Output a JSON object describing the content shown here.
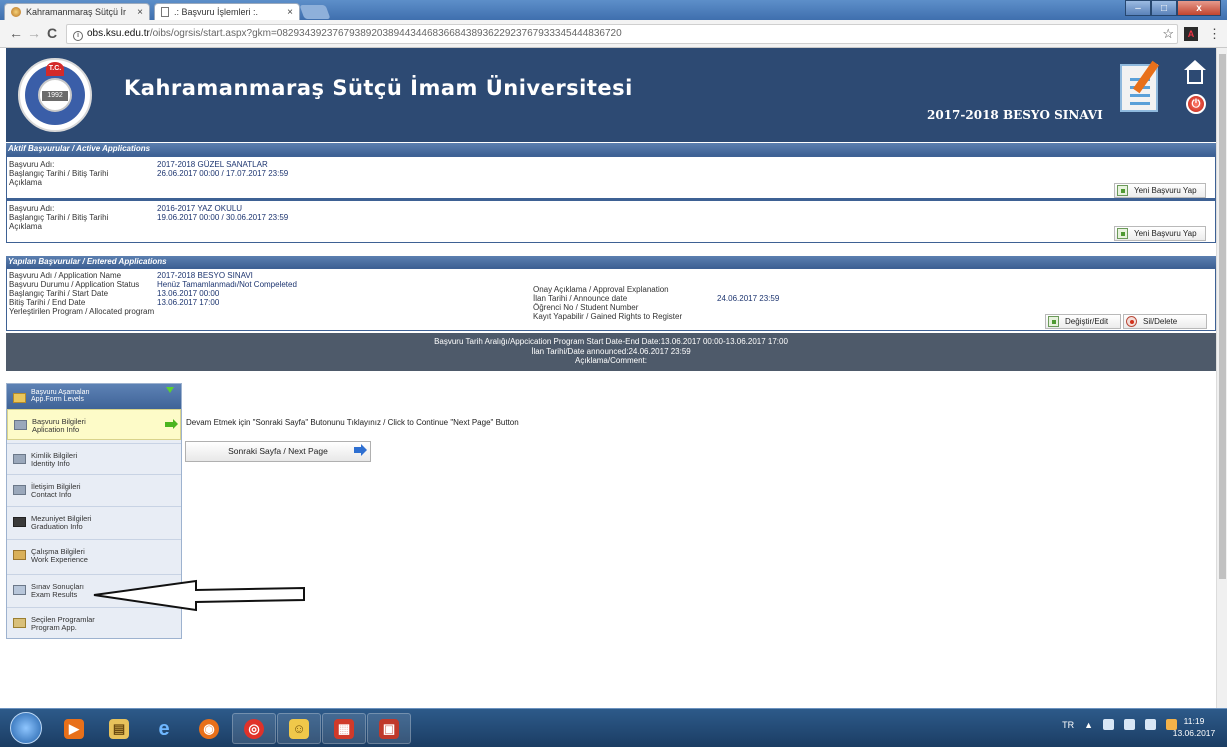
{
  "browser": {
    "tabs": [
      {
        "title": "Kahramanmaraş Sütçü İr"
      },
      {
        "title": ".: Başvuru İşlemleri :."
      }
    ],
    "close_glyph": "×",
    "url_host": "obs.ksu.edu.tr",
    "url_path": "/oibs/ogrsis/start.aspx?gkm=08293439237679389203894434468366843893622923767933345444836720",
    "window_controls": {
      "minimize": "–",
      "maximize": "□",
      "close": "x"
    },
    "nav": {
      "back": "←",
      "forward": "→",
      "reload": "C"
    },
    "info_glyph": "i",
    "star_glyph": "☆",
    "menu_glyph": "⋮",
    "pdf_glyph": "A"
  },
  "header": {
    "university_name": "Kahramanmaraş Sütçü İmam Üniversitesi",
    "exam_title": "2017-2018 BESYO SINAVI",
    "logo_tc": "T.C.",
    "logo_year": "1992",
    "icons": [
      "logo-icon",
      "document-pen-icon",
      "home-icon",
      "power-icon"
    ],
    "power_glyph": "⏻"
  },
  "active_apps": {
    "section_title": "Aktif Başvurular / Active Applications",
    "labels": [
      "Başvuru Adı:",
      "Başlangıç Tarihi / Bitiş Tarihi",
      "Açıklama"
    ],
    "items": [
      {
        "name": "2017-2018 GÜZEL SANATLAR",
        "dates": "26.06.2017 00:00  /  17.07.2017 23:59",
        "button": "Yeni Başvuru Yap"
      },
      {
        "name": "2016-2017 YAZ OKULU",
        "dates": "19.06.2017 00:00  /  30.06.2017 23:59",
        "button": "Yeni Başvuru Yap"
      }
    ]
  },
  "entered_apps": {
    "section_title": "Yapılan Başvurular / Entered Applications",
    "left_labels": [
      "Başvuru Adı / Application Name",
      "Başvuru Durumu / Application Status",
      "Başlangıç Tarihi / Start Date",
      "Bitiş Tarihi / End Date",
      "Yerleştirilen Program / Allocated program"
    ],
    "left_values": [
      "2017-2018 BESYO SINAVI",
      "Henüz Tamamlanmadı/Not Compeleted",
      "13.06.2017 00:00",
      "13.06.2017 17:00",
      ""
    ],
    "right_labels": [
      "Onay Açıklama / Approval Explanation",
      "İlan Tarihi / Announce date",
      "Öğrenci No / Student Number",
      "Kayıt Yapabilir / Gained Rights to Register"
    ],
    "right_values": [
      "",
      "24.06.2017 23:59",
      "",
      ""
    ],
    "edit_button": "Değiştir/Edit",
    "delete_button": "Sil/Delete"
  },
  "info_bar": {
    "line1": "Başvuru Tarih Aralığı/Appcication Program Start Date-End Date:13.06.2017 00:00-13.06.2017 17:00",
    "line2": "İlan Tarihi/Date announced:24.06.2017 23:59",
    "line3": "Açıklama/Comment:"
  },
  "sidebar": {
    "title_tr": "Başvuru Aşamaları",
    "title_en": "App.Form Levels",
    "items": [
      {
        "tr": "Başvuru Bilgileri",
        "en": "Aplication Info",
        "icon": "book-icon",
        "active": true
      },
      {
        "tr": "Kimlik Bilgileri",
        "en": "Identity Info",
        "icon": "identity-icon",
        "active": false
      },
      {
        "tr": "İletişim Bilgileri",
        "en": "Contact Info",
        "icon": "contact-icon",
        "active": false
      },
      {
        "tr": "Mezuniyet Bilgileri",
        "en": "Graduation Info",
        "icon": "graduation-cap-icon",
        "active": false
      },
      {
        "tr": "Çalışma Bilgileri",
        "en": "Work Experience",
        "icon": "briefcase-icon",
        "active": false
      },
      {
        "tr": "Sınav Sonuçları",
        "en": "Exam Results",
        "icon": "exam-icon",
        "active": false
      },
      {
        "tr": "Seçilen Programlar",
        "en": "Program App.",
        "icon": "program-icon",
        "active": false
      }
    ]
  },
  "main": {
    "instruction": "Devam Etmek için \"Sonraki Sayfa\" Butonunu Tıklayınız / Click to Continue \"Next Page\" Button",
    "next_button": "Sonraki Sayfa / Next Page"
  },
  "taskbar": {
    "apps": [
      "windows-start-icon",
      "media-player-icon",
      "file-explorer-icon",
      "internet-explorer-icon",
      "firefox-icon",
      "chrome-icon",
      "folder-app-icon",
      "app-red-icon",
      "app-presentation-icon"
    ],
    "glyphs": [
      "▶",
      "▤",
      "e",
      "◉",
      "◎",
      "☺",
      "▦",
      "▣"
    ],
    "language": "TR",
    "tray_arrow": "▲",
    "time": "11:19",
    "date": "13.06.2017"
  },
  "colors": {
    "header_bg": "#2d4a73",
    "section_bar": "#3e6194",
    "info_bar": "#4e5a6a",
    "active_item": "#fdfbc8"
  }
}
